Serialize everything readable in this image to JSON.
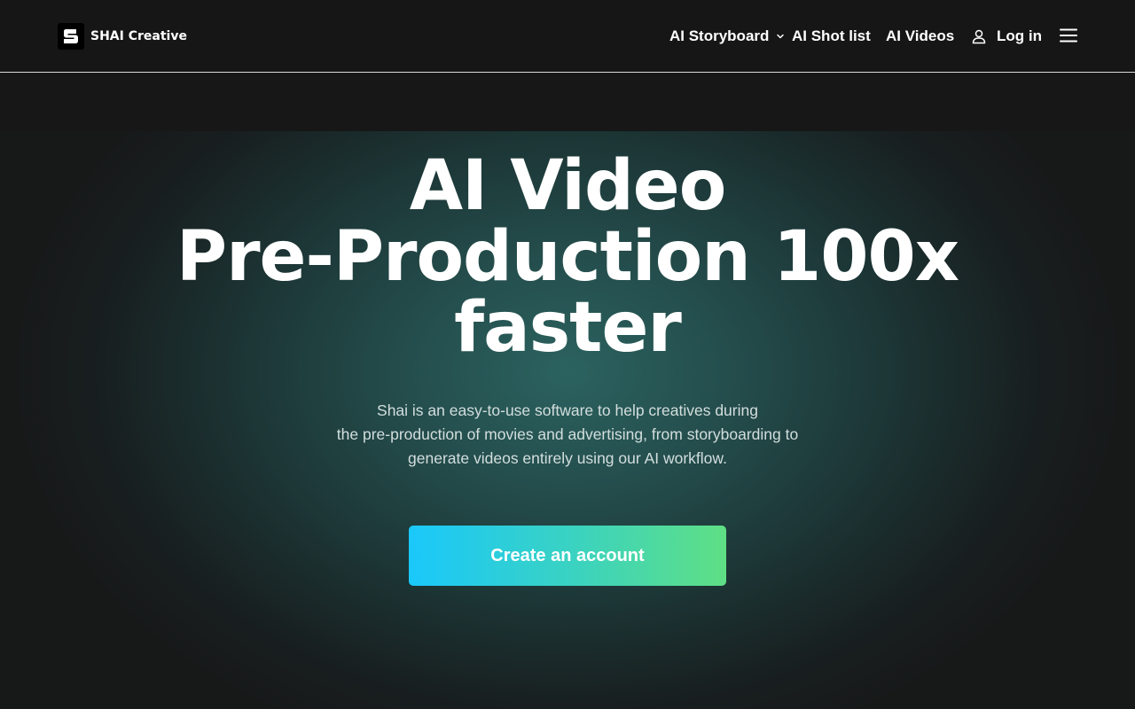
{
  "header": {
    "brand": "SHAI Creative",
    "nav": {
      "storyboard": "AI Storyboard",
      "shotlist": "AI Shot list",
      "videos": "AI Videos",
      "login": "Log in"
    },
    "icons": {
      "logo": "shai-logo-icon",
      "dropdown": "chevron-down-icon",
      "user": "user-icon",
      "menu": "hamburger-menu-icon"
    }
  },
  "hero": {
    "title_lines": [
      "AI Video",
      "Pre-Production 100x",
      "faster"
    ],
    "description_lines": [
      "Shai is an easy-to-use software to help creatives during",
      "the pre-production of movies and advertising, from storyboarding to",
      "generate videos entirely using our AI workflow."
    ],
    "cta_label": "Create an account"
  },
  "colors": {
    "background": "#171718",
    "header_border": "#d9d9d9",
    "glow_center": "#2b625f",
    "cta_gradient_start": "#1ac8fb",
    "cta_gradient_end": "#5fdf84",
    "text_primary": "#ffffff",
    "text_secondary": "#d3dedd"
  }
}
